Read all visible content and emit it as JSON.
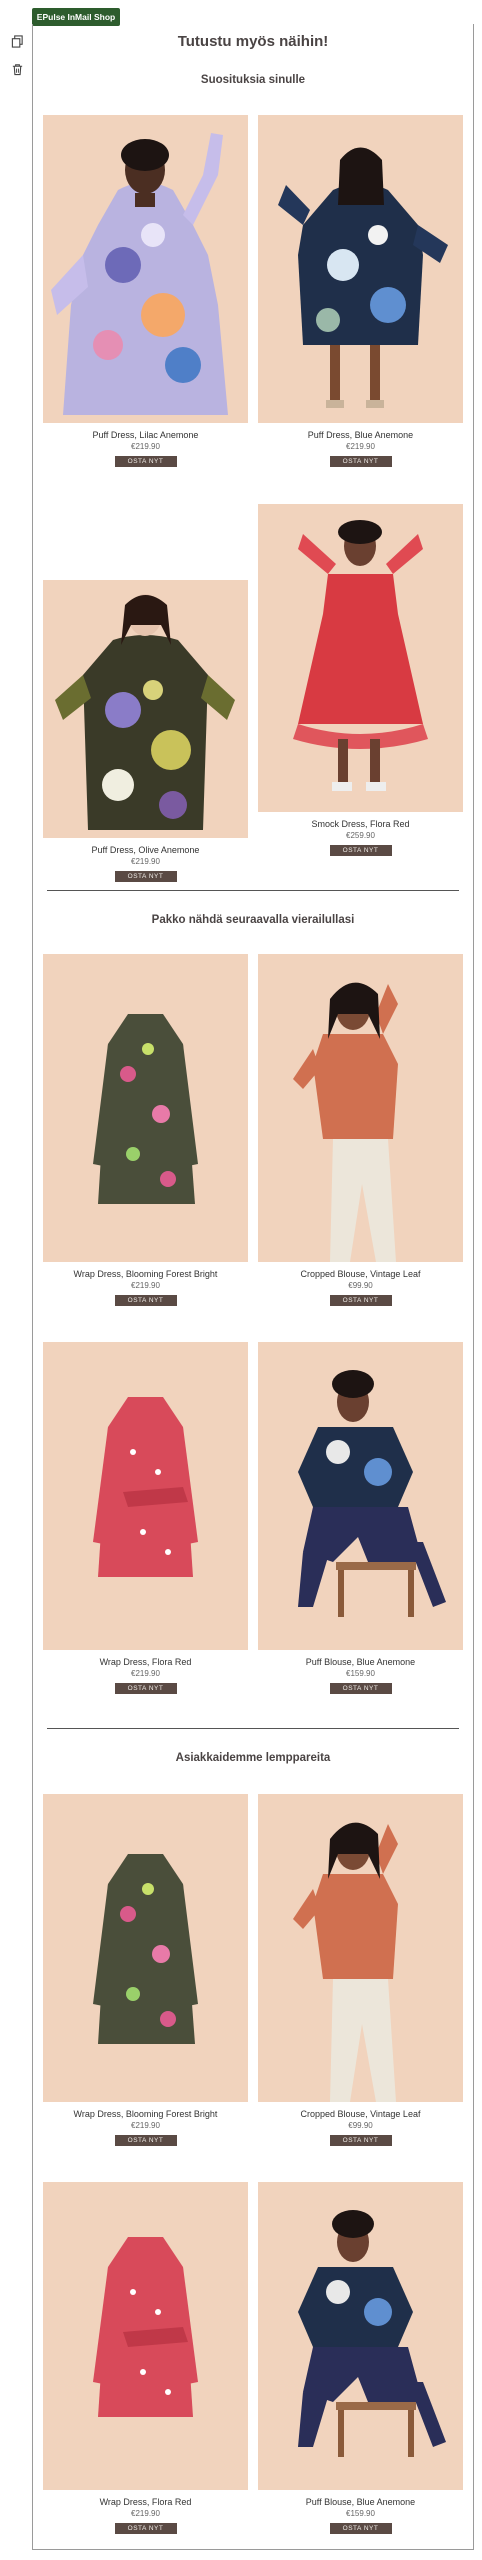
{
  "app": {
    "tag": "EPulse InMail Shop"
  },
  "main_title": "Tutustu myös näihin!",
  "sections": [
    {
      "title": "Suosituksia sinulle",
      "products": [
        {
          "name": "Puff Dress, Lilac Anemone",
          "price": "€219.90",
          "cta": "OSTA NYT"
        },
        {
          "name": "Puff Dress, Blue Anemone",
          "price": "€219.90",
          "cta": "OSTA NYT"
        },
        {
          "name": "Puff Dress, Olive Anemone",
          "price": "€219.90",
          "cta": "OSTA NYT"
        },
        {
          "name": "Smock Dress, Flora Red",
          "price": "€259.90",
          "cta": "OSTA NYT"
        }
      ]
    },
    {
      "title": "Pakko nähdä seuraavalla vierailullasi",
      "products": [
        {
          "name": "Wrap Dress, Blooming Forest Bright",
          "price": "€219.90",
          "cta": "OSTA NYT"
        },
        {
          "name": "Cropped Blouse, Vintage Leaf",
          "price": "€99.90",
          "cta": "OSTA NYT"
        },
        {
          "name": "Wrap Dress, Flora Red",
          "price": "€219.90",
          "cta": "OSTA NYT"
        },
        {
          "name": "Puff Blouse, Blue Anemone",
          "price": "€159.90",
          "cta": "OSTA NYT"
        }
      ]
    },
    {
      "title": "Asiakkaidemme lemppareita",
      "products": [
        {
          "name": "Wrap Dress, Blooming Forest Bright",
          "price": "€219.90",
          "cta": "OSTA NYT"
        },
        {
          "name": "Cropped Blouse, Vintage Leaf",
          "price": "€99.90",
          "cta": "OSTA NYT"
        },
        {
          "name": "Wrap Dress, Flora Red",
          "price": "€219.90",
          "cta": "OSTA NYT"
        },
        {
          "name": "Puff Blouse, Blue Anemone",
          "price": "€159.90",
          "cta": "OSTA NYT"
        }
      ]
    }
  ],
  "icons": {
    "copy": "copy-icon",
    "delete": "trash-icon"
  },
  "colors": {
    "tag_bg": "#2d5c2d",
    "button_bg": "#5a4a44",
    "photo_bg": "#f1d3bd"
  }
}
